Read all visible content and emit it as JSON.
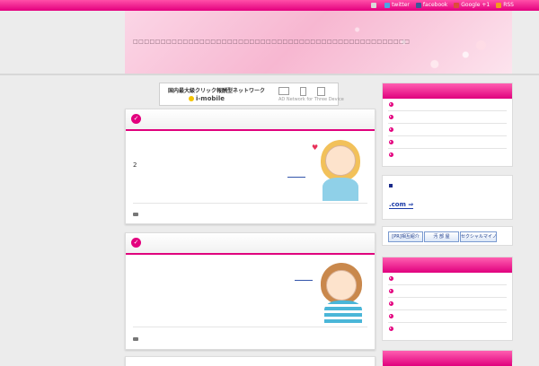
{
  "social": [
    {
      "icon": "mail-icon",
      "label": ""
    },
    {
      "icon": "twitter-icon",
      "label": "twitter"
    },
    {
      "icon": "facebook-icon",
      "label": "facebook"
    },
    {
      "icon": "google-plus-icon",
      "label": "Google +1"
    },
    {
      "icon": "rss-icon",
      "label": "RSS"
    }
  ],
  "header": {
    "description": "□□□□□□□□□□□□□□□□□□□□□□□□□□□□□□□□□□□□□□□□□□□□□□□□□□"
  },
  "ad": {
    "title": "国内最大級クリック報酬型ネットワーク",
    "brand": "i-mobile",
    "subtitle": "AD Network for Three Device"
  },
  "posts": [
    {
      "text": "2"
    },
    {
      "text": ""
    }
  ],
  "widget2": {
    "link": ".com ⇒"
  },
  "banners": [
    "[PR]相互紹介",
    "汚 部 屋",
    "セクシャルマイノリティ"
  ],
  "colors": {
    "accent": "#e3007e"
  }
}
